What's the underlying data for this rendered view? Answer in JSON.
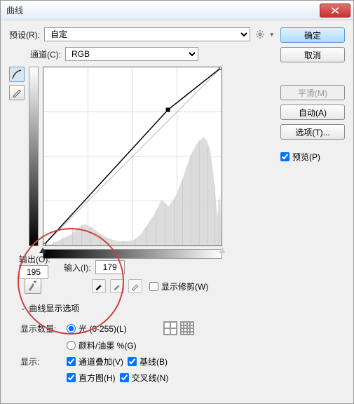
{
  "window": {
    "title": "曲线"
  },
  "preset": {
    "label": "预设(R):",
    "value": "自定"
  },
  "channel": {
    "label": "通道(C):",
    "value": "RGB"
  },
  "output": {
    "label": "输出(O):",
    "value": "195"
  },
  "input": {
    "label": "输入(I):",
    "value": "179"
  },
  "show_clip": {
    "label": "显示修剪(W)"
  },
  "disclose": {
    "label": "曲线显示选项"
  },
  "show_amount": {
    "label": "显示数量:",
    "light": "光 (0-255)(L)",
    "pigment": "颜料/油墨 %(G)"
  },
  "show": {
    "label": "显示:",
    "overlay": "通道叠加(V)",
    "baseline": "基线(B)",
    "histogram": "直方图(H)",
    "intersection": "交叉线(N)"
  },
  "buttons": {
    "ok": "确定",
    "cancel": "取消",
    "smooth": "平滑(M)",
    "auto": "自动(A)",
    "options": "选项(T)..."
  },
  "preview": {
    "label": "预览(P)"
  },
  "chart_data": {
    "type": "line",
    "title": "",
    "xlabel": "输入",
    "ylabel": "输出",
    "xlim": [
      0,
      255
    ],
    "ylim": [
      0,
      255
    ],
    "grid": true,
    "points": [
      {
        "x": 0,
        "y": 0
      },
      {
        "x": 179,
        "y": 195
      },
      {
        "x": 255,
        "y": 255
      }
    ],
    "baseline": [
      {
        "x": 0,
        "y": 0
      },
      {
        "x": 255,
        "y": 255
      }
    ],
    "histogram_hint": "background histogram peaks roughly near x≈60 small, dip to 120, rise to large peak ≈210-240"
  }
}
